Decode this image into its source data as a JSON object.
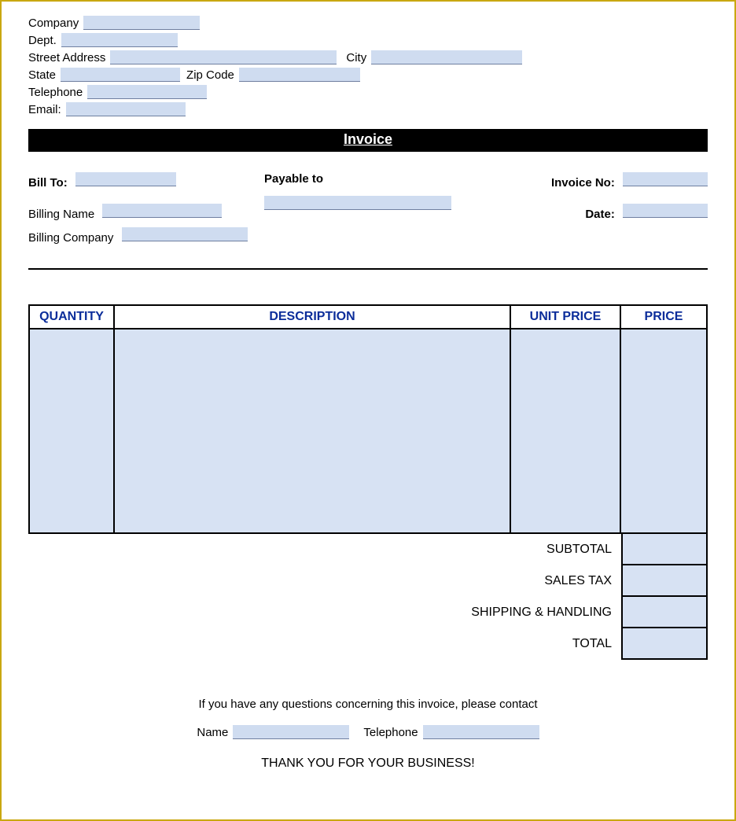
{
  "sender": {
    "company_label": "Company",
    "dept_label": "Dept.",
    "street_label": "Street Address",
    "city_label": "City",
    "state_label": "State",
    "zip_label": "Zip Code",
    "phone_label": "Telephone",
    "email_label": "Email:"
  },
  "title_bar": "Invoice",
  "billing": {
    "bill_to_label": "Bill To:",
    "payable_to_label": "Payable to",
    "invoice_no_label": "Invoice No:",
    "billing_name_label": "Billing Name",
    "billing_company_label": "Billing Company",
    "date_label": "Date:"
  },
  "table": {
    "headers": {
      "quantity": "QUANTITY",
      "description": "DESCRIPTION",
      "unit_price": "UNIT PRICE",
      "price": "PRICE"
    }
  },
  "totals": {
    "subtotal": "SUBTOTAL",
    "sales_tax": "SALES TAX",
    "shipping": "SHIPPING & HANDLING",
    "total": "TOTAL"
  },
  "footer": {
    "questions": "If you have any questions concerning this invoice, please contact",
    "name_label": "Name",
    "telephone_label": "Telephone",
    "thank_you": "THANK YOU FOR YOUR BUSINESS!"
  }
}
